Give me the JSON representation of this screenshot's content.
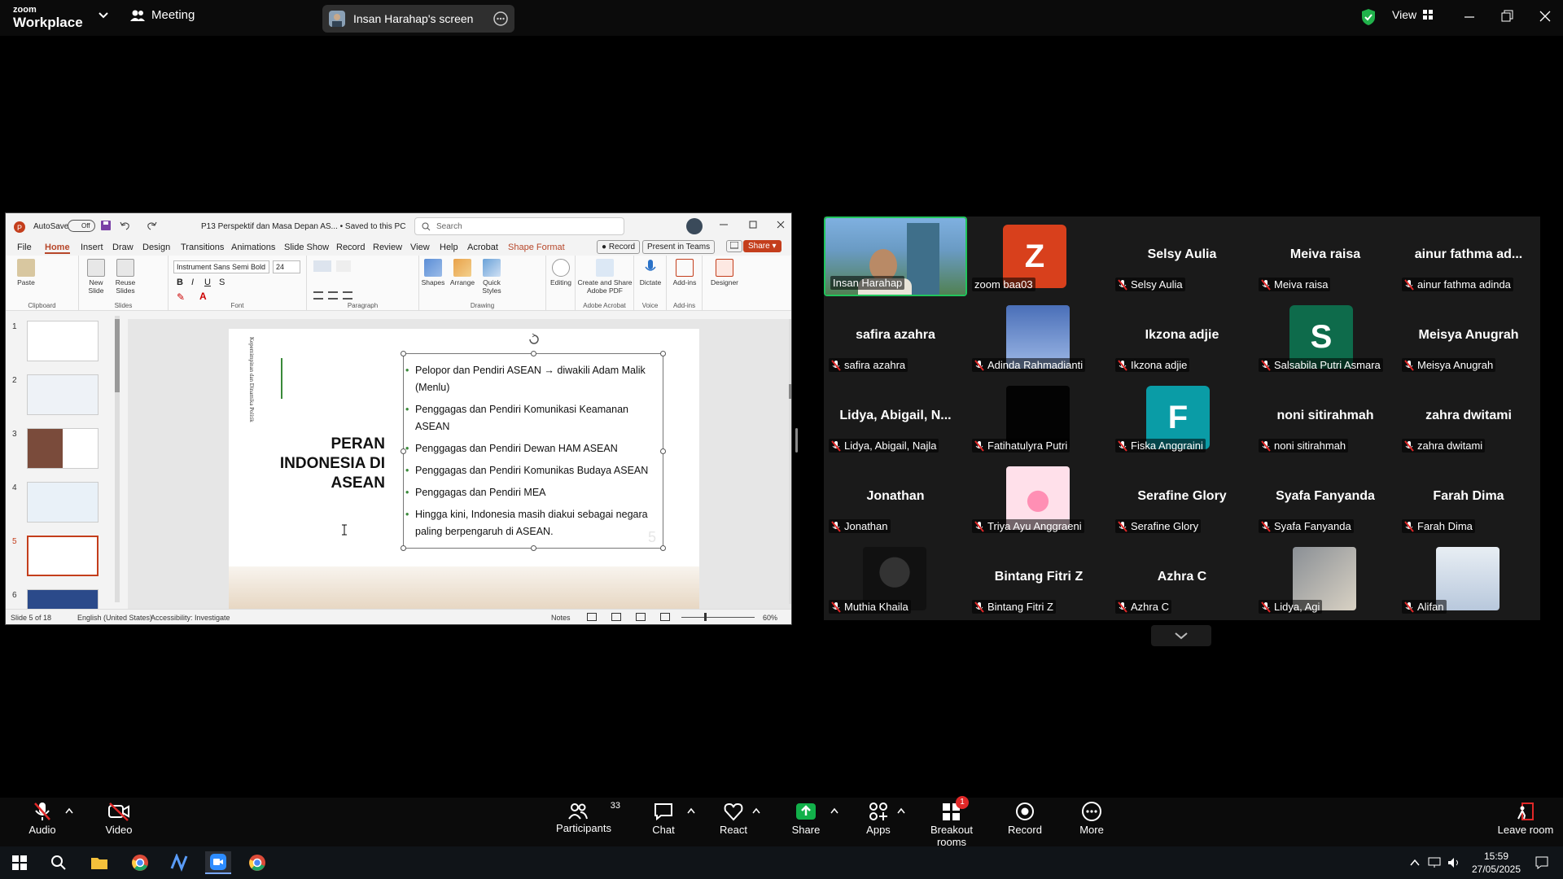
{
  "topbar": {
    "brand_top": "zoom",
    "brand_bottom": "Workplace",
    "meeting_label": "Meeting",
    "share_label": "Insan Harahap's screen",
    "view_label": "View"
  },
  "ppt": {
    "autosave": "AutoSave",
    "autosave_state": "Off",
    "doc_title": "P13 Perspektif dan Masa Depan AS... • Saved to this PC",
    "search_placeholder": "Search",
    "menu": [
      "File",
      "Home",
      "Insert",
      "Draw",
      "Design",
      "Transitions",
      "Animations",
      "Slide Show",
      "Record",
      "Review",
      "View",
      "Help",
      "Acrobat",
      "Shape Format"
    ],
    "record_btn": "Record",
    "present_btn": "Present in Teams",
    "share_btn": "Share",
    "font_name": "Instrument Sans Semi Bold",
    "font_size": "24",
    "ribbon": {
      "paste": "Paste",
      "new_slide": "New Slide",
      "reuse_slides": "Reuse Slides",
      "shapes": "Shapes",
      "arrange": "Arrange",
      "quick_styles": "Quick Styles",
      "editing": "Editing",
      "create_pdf": "Create and Share Adobe PDF",
      "dictate": "Dictate",
      "addins": "Add-ins",
      "designer": "Designer",
      "groups": [
        "Clipboard",
        "Slides",
        "Font",
        "Paragraph",
        "Drawing",
        "Adobe Acrobat",
        "Voice",
        "Add-ins"
      ]
    },
    "thumb_numbers": [
      "1",
      "2",
      "3",
      "4",
      "5",
      "6"
    ],
    "slide": {
      "side_text": "Kepemimpinan dan Dinamika Politik",
      "heading_line1": "PERAN",
      "heading_line2": "INDONESIA DI",
      "heading_line3": "ASEAN",
      "bullets": [
        "Pelopor dan Pendiri ASEAN → diwakili Adam Malik (Menlu)",
        "Penggagas dan Pendiri Komunikasi Keamanan ASEAN",
        "Penggagas dan Pendiri Dewan HAM ASEAN",
        "Penggagas dan Pendiri Komunikas Budaya ASEAN",
        "Penggagas dan Pendiri MEA",
        "Hingga kini, Indonesia masih diakui sebagai negara paling berpengaruh di ASEAN."
      ],
      "page_num": "5"
    },
    "status": {
      "slide_of": "Slide 5 of 18",
      "language": "English (United States)",
      "accessibility": "Accessibility: Investigate",
      "notes": "Notes",
      "zoom": "60%"
    }
  },
  "gallery": {
    "tiles": [
      {
        "big": "",
        "label": "Insan Harahap",
        "muted": false,
        "kind": "video"
      },
      {
        "big": "Z",
        "label": "zoom baa03",
        "muted": false,
        "kind": "avatar",
        "color": "#d8401c"
      },
      {
        "big": "Selsy Aulia",
        "label": "Selsy Aulia",
        "muted": true,
        "kind": "name"
      },
      {
        "big": "Meiva raisa",
        "label": "Meiva raisa",
        "muted": true,
        "kind": "name"
      },
      {
        "big": "ainur fathma ad...",
        "label": "ainur fathma adinda",
        "muted": true,
        "kind": "name"
      },
      {
        "big": "safira azahra",
        "label": "safira azahra",
        "muted": true,
        "kind": "name"
      },
      {
        "big": "",
        "label": "Adinda Rahmadianti",
        "muted": true,
        "kind": "photo-sky"
      },
      {
        "big": "Ikzona adjie",
        "label": "Ikzona adjie",
        "muted": true,
        "kind": "name"
      },
      {
        "big": "S",
        "label": "Salsabila Putri Asmara",
        "muted": true,
        "kind": "avatar",
        "color": "#0e6b4b"
      },
      {
        "big": "Meisya Anugrah",
        "label": "Meisya Anugrah",
        "muted": true,
        "kind": "name"
      },
      {
        "big": "Lidya, Abigail, N...",
        "label": "Lidya, Abigail, Najla",
        "muted": true,
        "kind": "name"
      },
      {
        "big": "",
        "label": "Fatihatulyra Putri",
        "muted": true,
        "kind": "photo-black"
      },
      {
        "big": "F",
        "label": "Fiska Anggraini",
        "muted": true,
        "kind": "avatar",
        "color": "#0a9ca6"
      },
      {
        "big": "noni sitirahmah",
        "label": "noni sitirahmah",
        "muted": true,
        "kind": "name"
      },
      {
        "big": "zahra dwitami",
        "label": "zahra dwitami",
        "muted": true,
        "kind": "name"
      },
      {
        "big": "Jonathan",
        "label": "Jonathan",
        "muted": true,
        "kind": "name"
      },
      {
        "big": "",
        "label": "Triya Ayu Anggraeni",
        "muted": true,
        "kind": "photo-heart"
      },
      {
        "big": "Serafine Glory",
        "label": "Serafine Glory",
        "muted": true,
        "kind": "name"
      },
      {
        "big": "Syafa Fanyanda",
        "label": "Syafa Fanyanda",
        "muted": true,
        "kind": "name"
      },
      {
        "big": "Farah Dima",
        "label": "Farah Dima",
        "muted": true,
        "kind": "name"
      },
      {
        "big": "",
        "label": "Muthia Khaila",
        "muted": true,
        "kind": "photo-dark"
      },
      {
        "big": "Bintang Fitri Z",
        "label": "Bintang Fitri Z",
        "muted": true,
        "kind": "name"
      },
      {
        "big": "Azhra C",
        "label": "Azhra C",
        "muted": true,
        "kind": "name"
      },
      {
        "big": "",
        "label": "Lidya, Agi",
        "muted": true,
        "kind": "photo-face"
      },
      {
        "big": "",
        "label": "Alifan",
        "muted": true,
        "kind": "photo-poster"
      }
    ]
  },
  "toolbar": {
    "audio": "Audio",
    "video": "Video",
    "participants": "Participants",
    "participants_count": "33",
    "chat": "Chat",
    "react": "React",
    "share": "Share",
    "apps": "Apps",
    "breakout": "Breakout rooms",
    "breakout_badge": "1",
    "record": "Record",
    "more": "More",
    "leave": "Leave room"
  },
  "taskbar": {
    "time": "15:59",
    "date": "27/05/2025"
  }
}
